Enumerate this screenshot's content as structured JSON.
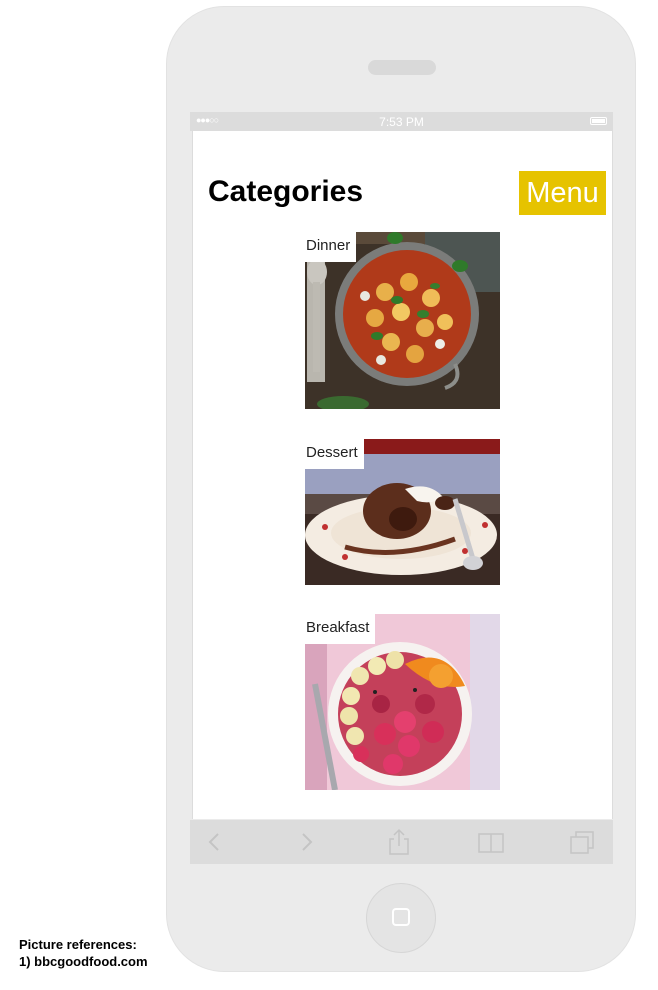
{
  "status_bar": {
    "signal": "●●●○○",
    "time": "7:53 PM"
  },
  "header": {
    "title": "Categories",
    "menu_label": "Menu"
  },
  "categories": [
    {
      "label": "Dinner",
      "image": "gnocchi-tomato-pan-photo"
    },
    {
      "label": "Dessert",
      "image": "chocolate-pudding-plate-photo"
    },
    {
      "label": "Breakfast",
      "image": "raspberry-orange-bowl-photo"
    }
  ],
  "toolbar": {
    "icons": [
      "back-icon",
      "forward-icon",
      "share-icon",
      "bookmarks-icon",
      "tabs-icon"
    ]
  },
  "colors": {
    "accent": "#e6c300",
    "device": "#ebebeb",
    "toolbar": "#dcdcdc"
  },
  "references": {
    "heading": "Picture references:",
    "items": [
      "1)  bbcgoodfood.com"
    ]
  }
}
